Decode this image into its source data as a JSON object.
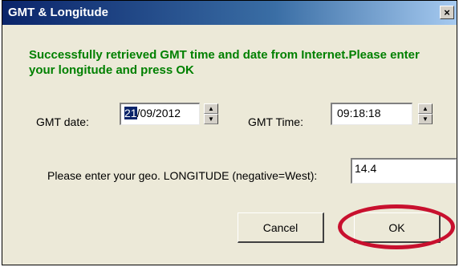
{
  "window": {
    "title": "GMT & Longitude",
    "close_glyph": "×"
  },
  "message": "Successfully retrieved GMT time and date from Internet.Please enter your longitude and press OK",
  "gmt_date": {
    "label": "GMT date:",
    "value_selected": "21",
    "value_rest": "/09/2012"
  },
  "gmt_time": {
    "label": "GMT Time:",
    "value": "09:18:18"
  },
  "longitude": {
    "label": "Please enter your geo. LONGITUDE (negative=West):",
    "value": "14.4"
  },
  "buttons": {
    "cancel": "Cancel",
    "ok": "OK"
  },
  "annotation": {
    "ring_color": "#c8102e"
  }
}
